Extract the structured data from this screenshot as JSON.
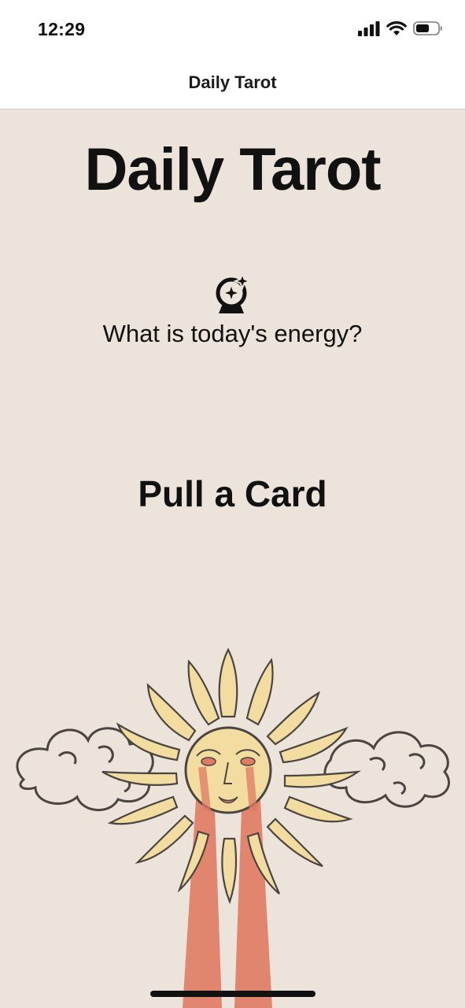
{
  "status_bar": {
    "time": "12:29",
    "icons": [
      "cellular-signal-icon",
      "wifi-icon",
      "battery-icon"
    ]
  },
  "nav": {
    "title": "Daily Tarot"
  },
  "main": {
    "title": "Daily Tarot",
    "icon": "crystal-ball-icon",
    "subtitle": "What is today's energy?",
    "pull_button_label": "Pull a Card",
    "illustration": "sun-illustration"
  },
  "colors": {
    "background": "#ece3da",
    "bar_background": "#ffffff",
    "sun_yellow": "#f3dca0",
    "ray_red": "#e07b63",
    "outline": "#4a4540"
  }
}
